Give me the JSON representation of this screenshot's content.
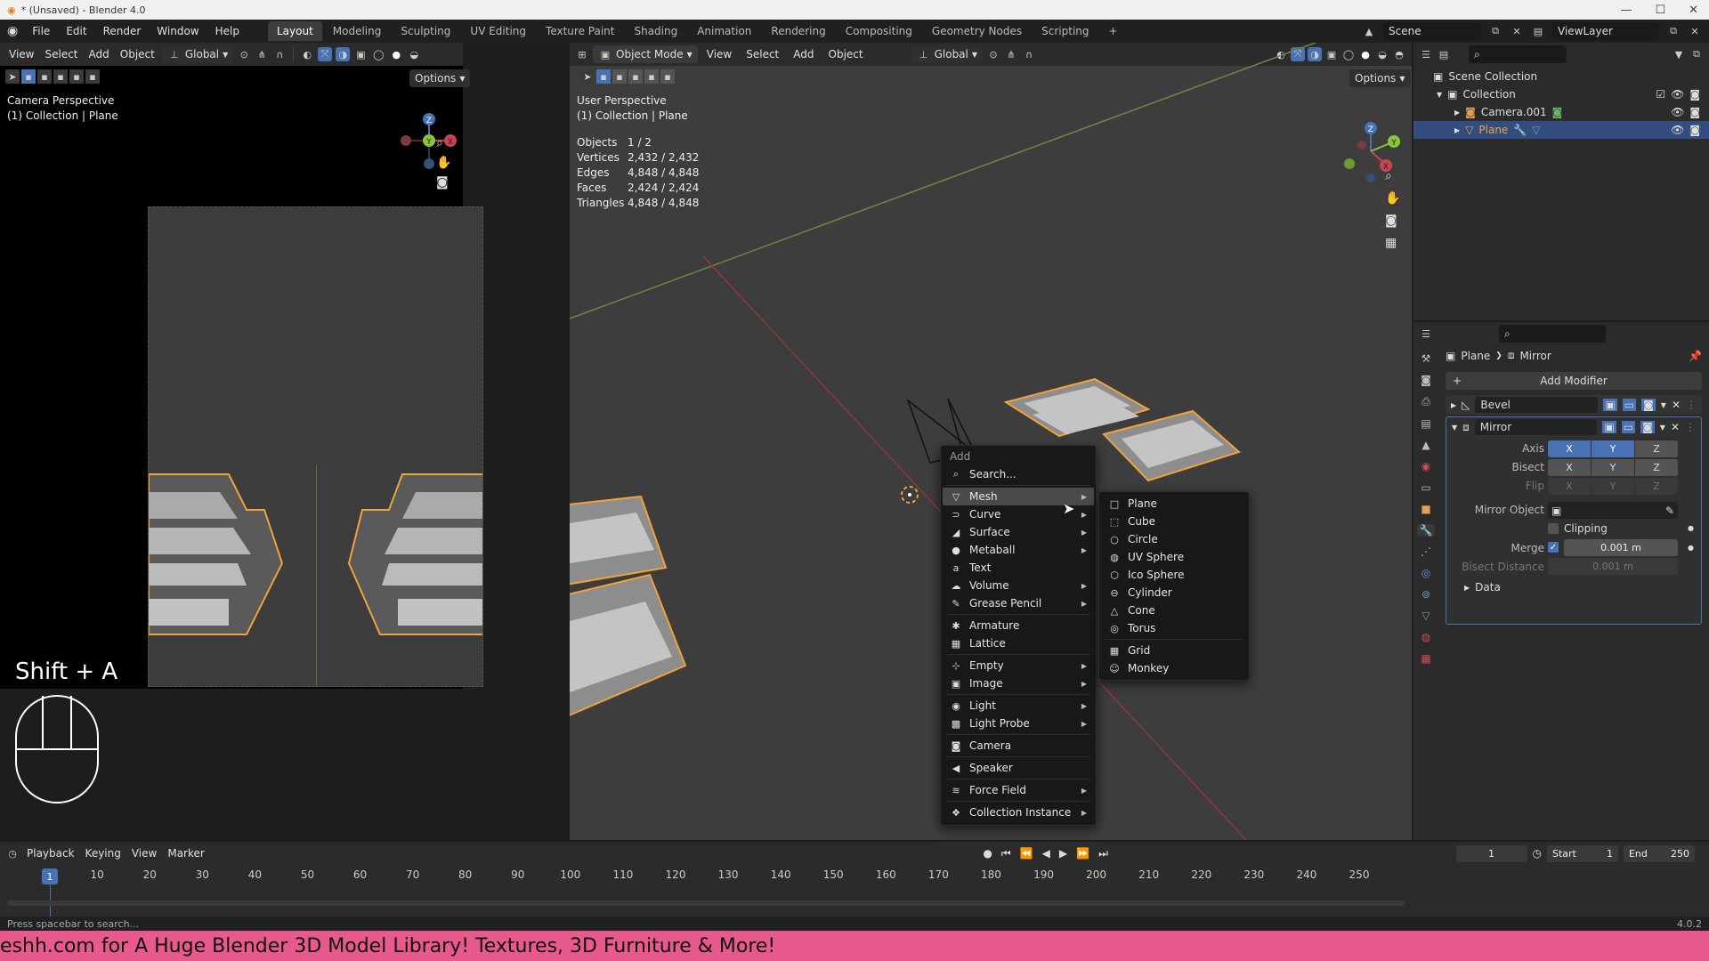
{
  "window": {
    "title": "* (Unsaved) - Blender 4.0"
  },
  "topbar": {
    "menus": [
      "File",
      "Edit",
      "Render",
      "Window",
      "Help"
    ],
    "workspaces": [
      "Layout",
      "Modeling",
      "Sculpting",
      "UV Editing",
      "Texture Paint",
      "Shading",
      "Animation",
      "Rendering",
      "Compositing",
      "Geometry Nodes",
      "Scripting"
    ],
    "active_workspace": "Layout",
    "add_tab": "+",
    "scene": "Scene",
    "view_layer": "ViewLayer"
  },
  "left_viewport": {
    "header_menus": [
      "View",
      "Select",
      "Add",
      "Object"
    ],
    "orientation": "Global",
    "options": "Options",
    "overlay_title": "Camera Perspective",
    "overlay_sub": "(1) Collection | Plane",
    "shortcut_hint": "Shift + A"
  },
  "main_viewport": {
    "mode": "Object Mode",
    "header_menus": [
      "View",
      "Select",
      "Add",
      "Object"
    ],
    "orientation": "Global",
    "options": "Options",
    "overlay_title": "User Perspective",
    "overlay_sub": "(1) Collection | Plane",
    "stats": [
      {
        "label": "Objects",
        "value": "1 / 2"
      },
      {
        "label": "Vertices",
        "value": "2,432 / 2,432"
      },
      {
        "label": "Edges",
        "value": "4,848 / 4,848"
      },
      {
        "label": "Faces",
        "value": "2,424 / 2,424"
      },
      {
        "label": "Triangles",
        "value": "4,848 / 4,848"
      }
    ]
  },
  "add_menu": {
    "title": "Add",
    "search": "Search...",
    "items": [
      {
        "label": "Mesh",
        "icon": "mesh-icon",
        "glyph": "▽",
        "sub": true,
        "hl": true
      },
      {
        "label": "Curve",
        "icon": "curve-icon",
        "glyph": "⊃",
        "sub": true
      },
      {
        "label": "Surface",
        "icon": "surface-icon",
        "glyph": "◢",
        "sub": true
      },
      {
        "label": "Metaball",
        "icon": "metaball-icon",
        "glyph": "●",
        "sub": true
      },
      {
        "label": "Text",
        "icon": "text-icon",
        "glyph": "a",
        "sub": false
      },
      {
        "label": "Volume",
        "icon": "volume-icon",
        "glyph": "☁",
        "sub": true
      },
      {
        "label": "Grease Pencil",
        "icon": "grease-pencil-icon",
        "glyph": "✎",
        "sub": true,
        "sep_after": true
      },
      {
        "label": "Armature",
        "icon": "armature-icon",
        "glyph": "✱",
        "sub": false
      },
      {
        "label": "Lattice",
        "icon": "lattice-icon",
        "glyph": "▦",
        "sub": false,
        "sep_after": true
      },
      {
        "label": "Empty",
        "icon": "empty-icon",
        "glyph": "⊹",
        "sub": true
      },
      {
        "label": "Image",
        "icon": "image-icon",
        "glyph": "▣",
        "sub": true,
        "sep_after": true
      },
      {
        "label": "Light",
        "icon": "light-icon",
        "glyph": "◉",
        "sub": true
      },
      {
        "label": "Light Probe",
        "icon": "light-probe-icon",
        "glyph": "▩",
        "sub": true,
        "sep_after": true
      },
      {
        "label": "Camera",
        "icon": "camera-icon",
        "glyph": "◙",
        "sub": false,
        "sep_after": true
      },
      {
        "label": "Speaker",
        "icon": "speaker-icon",
        "glyph": "◀",
        "sub": false,
        "sep_after": true
      },
      {
        "label": "Force Field",
        "icon": "force-field-icon",
        "glyph": "≋",
        "sub": true,
        "sep_after": true
      },
      {
        "label": "Collection Instance",
        "icon": "collection-instance-icon",
        "glyph": "❖",
        "sub": true
      }
    ]
  },
  "mesh_submenu": {
    "items": [
      {
        "label": "Plane",
        "glyph": "□"
      },
      {
        "label": "Cube",
        "glyph": "⬚"
      },
      {
        "label": "Circle",
        "glyph": "○"
      },
      {
        "label": "UV Sphere",
        "glyph": "◍"
      },
      {
        "label": "Ico Sphere",
        "glyph": "⬡"
      },
      {
        "label": "Cylinder",
        "glyph": "⊖"
      },
      {
        "label": "Cone",
        "glyph": "△"
      },
      {
        "label": "Torus",
        "glyph": "◎",
        "sep_after": true
      },
      {
        "label": "Grid",
        "glyph": "▦"
      },
      {
        "label": "Monkey",
        "glyph": "☺"
      }
    ]
  },
  "outliner": {
    "root": "Scene Collection",
    "collection": "Collection",
    "objects": [
      {
        "name": "Camera.001",
        "selected": false
      },
      {
        "name": "Plane",
        "selected": true
      }
    ]
  },
  "properties": {
    "breadcrumb_object": "Plane",
    "breadcrumb_modifier": "Mirror",
    "add_modifier": "Add Modifier",
    "modifiers": [
      {
        "name": "Bevel",
        "expanded": false
      },
      {
        "name": "Mirror",
        "expanded": true
      }
    ],
    "mirror": {
      "axis_label": "Axis",
      "bisect_label": "Bisect",
      "flip_label": "Flip",
      "axes": [
        "X",
        "Y",
        "Z"
      ],
      "mirror_object_label": "Mirror Object",
      "clipping_label": "Clipping",
      "merge_label": "Merge",
      "merge_value": "0.001 m",
      "bisect_distance_label": "Bisect Distance",
      "bisect_distance_value": "0.001 m",
      "data_label": "Data"
    }
  },
  "timeline": {
    "menus": [
      "Playback",
      "Keying",
      "View",
      "Marker"
    ],
    "current_frame": "1",
    "start_label": "Start",
    "start": "1",
    "end_label": "End",
    "end": "250",
    "ticks": [
      "10",
      "20",
      "30",
      "40",
      "50",
      "60",
      "70",
      "80",
      "90",
      "100",
      "110",
      "120",
      "130",
      "140",
      "150",
      "160",
      "170",
      "180",
      "190",
      "200",
      "210",
      "220",
      "230",
      "240",
      "250"
    ],
    "playhead": "1"
  },
  "statusbar": {
    "hint": "Press spacebar to search...",
    "version": "4.0.2"
  },
  "banner": {
    "text": "eshh.com for A Huge Blender 3D Model Library! Textures, 3D Furniture & More!"
  },
  "colors": {
    "selection": "#f0a33b",
    "accent": "#4772b3",
    "banner_bg": "#e85a8e"
  }
}
